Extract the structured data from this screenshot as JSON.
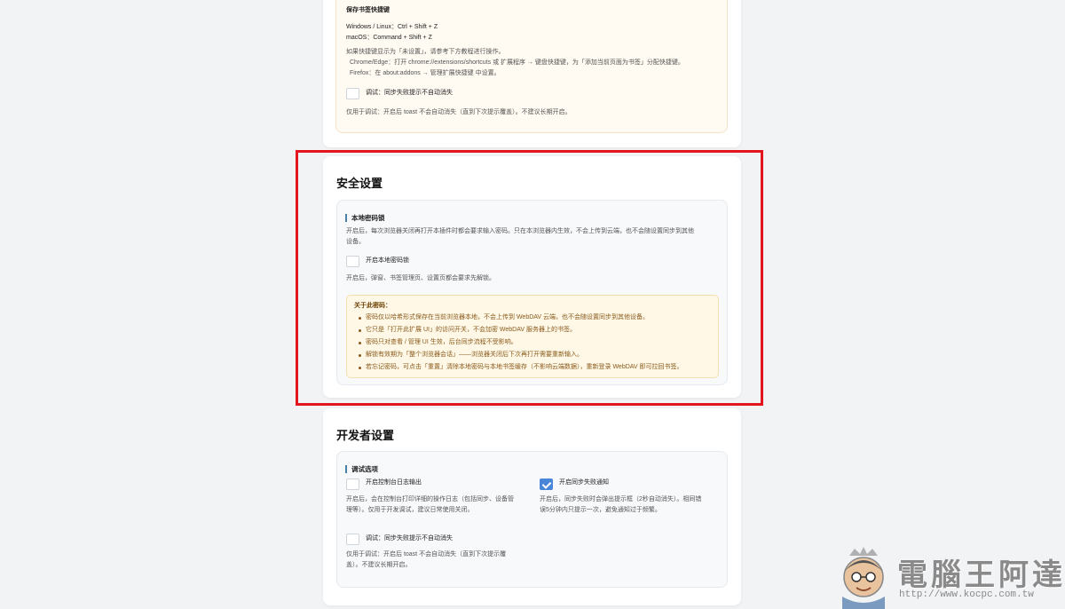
{
  "shortcut_card": {
    "heading": "保存书签快捷键",
    "win_line": "Windows / Linux：Ctrl + Shift + Z",
    "mac_line": "macOS：Command + Shift + Z",
    "note": "如果快捷键显示为「未设置」，请参考下方教程进行操作。",
    "chrome_line": "Chrome/Edge：打开 chrome://extensions/shortcuts 或 扩展程序 → 键盘快捷键，为「添加当前页面为书签」分配快捷键。",
    "firefox_line": "Firefox：在 about:addons → 管理扩展快捷键 中设置。",
    "debug_label": "调试：同步失败提示不自动消失",
    "debug_desc": "仅用于调试：开启后 toast 不会自动消失（直到下次提示覆盖）。不建议长期开启。"
  },
  "security": {
    "title": "安全设置",
    "subheading": "本地密码锁",
    "desc_line1": "开启后，每次浏览器关闭再打开本插件时都会要求输入密码。只在本浏览器内生效，不会上传到云端，也不会随设置同步到其他",
    "desc_line2": "设备。",
    "checkbox_label": "开启本地密码锁",
    "after_desc": "开启后，弹窗、书签管理页、设置页都会要求先解锁。",
    "warn_title": "关于此密码：",
    "warn_items": [
      "密码仅以哈希形式保存在当前浏览器本地，不会上传到 WebDAV 云端，也不会随设置同步到其他设备。",
      "它只是「打开此扩展 UI」的访问开关，不会加密 WebDAV 服务器上的书签。",
      "密码只对查看 / 管理 UI 生效，后台同步流程不受影响。",
      "解锁有效期为「整个浏览器会话」——浏览器关闭后下次再打开需要重新输入。",
      "若忘记密码，可点击「重置」清除本地密码与本地书签缓存（不影响云端数据），重新登录 WebDAV 即可拉回书签。"
    ]
  },
  "developer": {
    "title": "开发者设置",
    "subheading": "调试选项",
    "console_label": "开启控制台日志输出",
    "console_desc_1": "开启后，会在控制台打印详细的操作日志（包括同步、设备管",
    "console_desc_2": "理等）。仅用于开发调试，建议日常使用关闭。",
    "notify_label": "开启同步失败通知",
    "notify_desc_1": "开启后，同步失败时会弹出提示框（2秒自动消失）。相同错",
    "notify_desc_2": "误5分钟内只提示一次，避免通知过于频繁。",
    "debug_label": "调试：同步失败提示不自动消失",
    "debug_desc_1": "仅用于调试：开启后 toast 不会自动消失（直到下次提示覆",
    "debug_desc_2": "盖）。不建议长期开启。"
  },
  "watermark": {
    "text": "電腦王阿達",
    "url": "http://www.kocpc.com.tw"
  },
  "colors": {
    "highlight_border": "#e3151e",
    "checkbox_checked": "#4a86d8",
    "accent_bar": "#4a7fa8"
  }
}
